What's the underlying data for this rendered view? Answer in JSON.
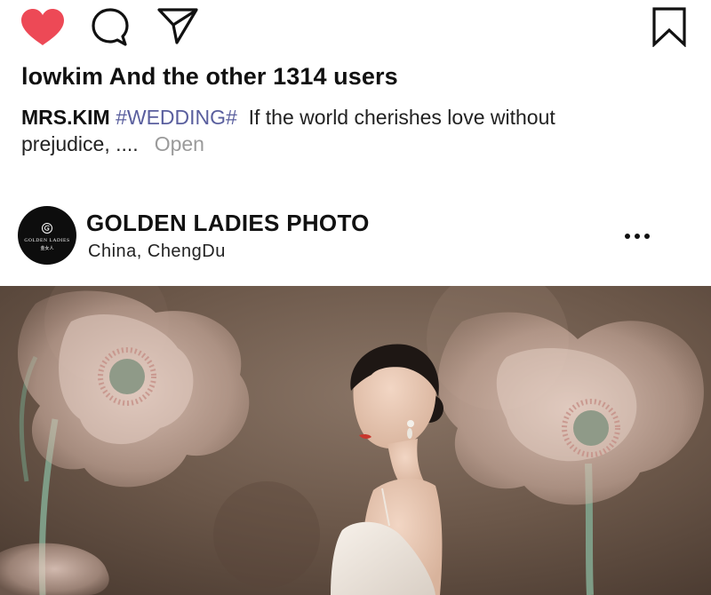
{
  "actions": {
    "like_icon": "heart-filled-icon",
    "comment_icon": "comment-bubble-icon",
    "share_icon": "paper-plane-icon",
    "save_icon": "bookmark-icon",
    "like_color": "#ed4956"
  },
  "likes": {
    "text": "lowkim And the other 1314 users"
  },
  "caption": {
    "author": "MRS.KIM",
    "hashtag": "#WEDDING#",
    "text": "If the world cherishes love without prejudice, ....",
    "more": "Open",
    "hashtag_color": "#5a5f9e"
  },
  "post": {
    "account_name": "GOLDEN LADIES PHOTO",
    "location": "China,  ChengDu",
    "avatar": {
      "brand": "GOLDEN LADIES",
      "brand_cn": "金女人"
    },
    "more_icon": "more-horizontal-icon",
    "photo_alt": "Bride in white gown beside giant sheer poppy flowers"
  }
}
